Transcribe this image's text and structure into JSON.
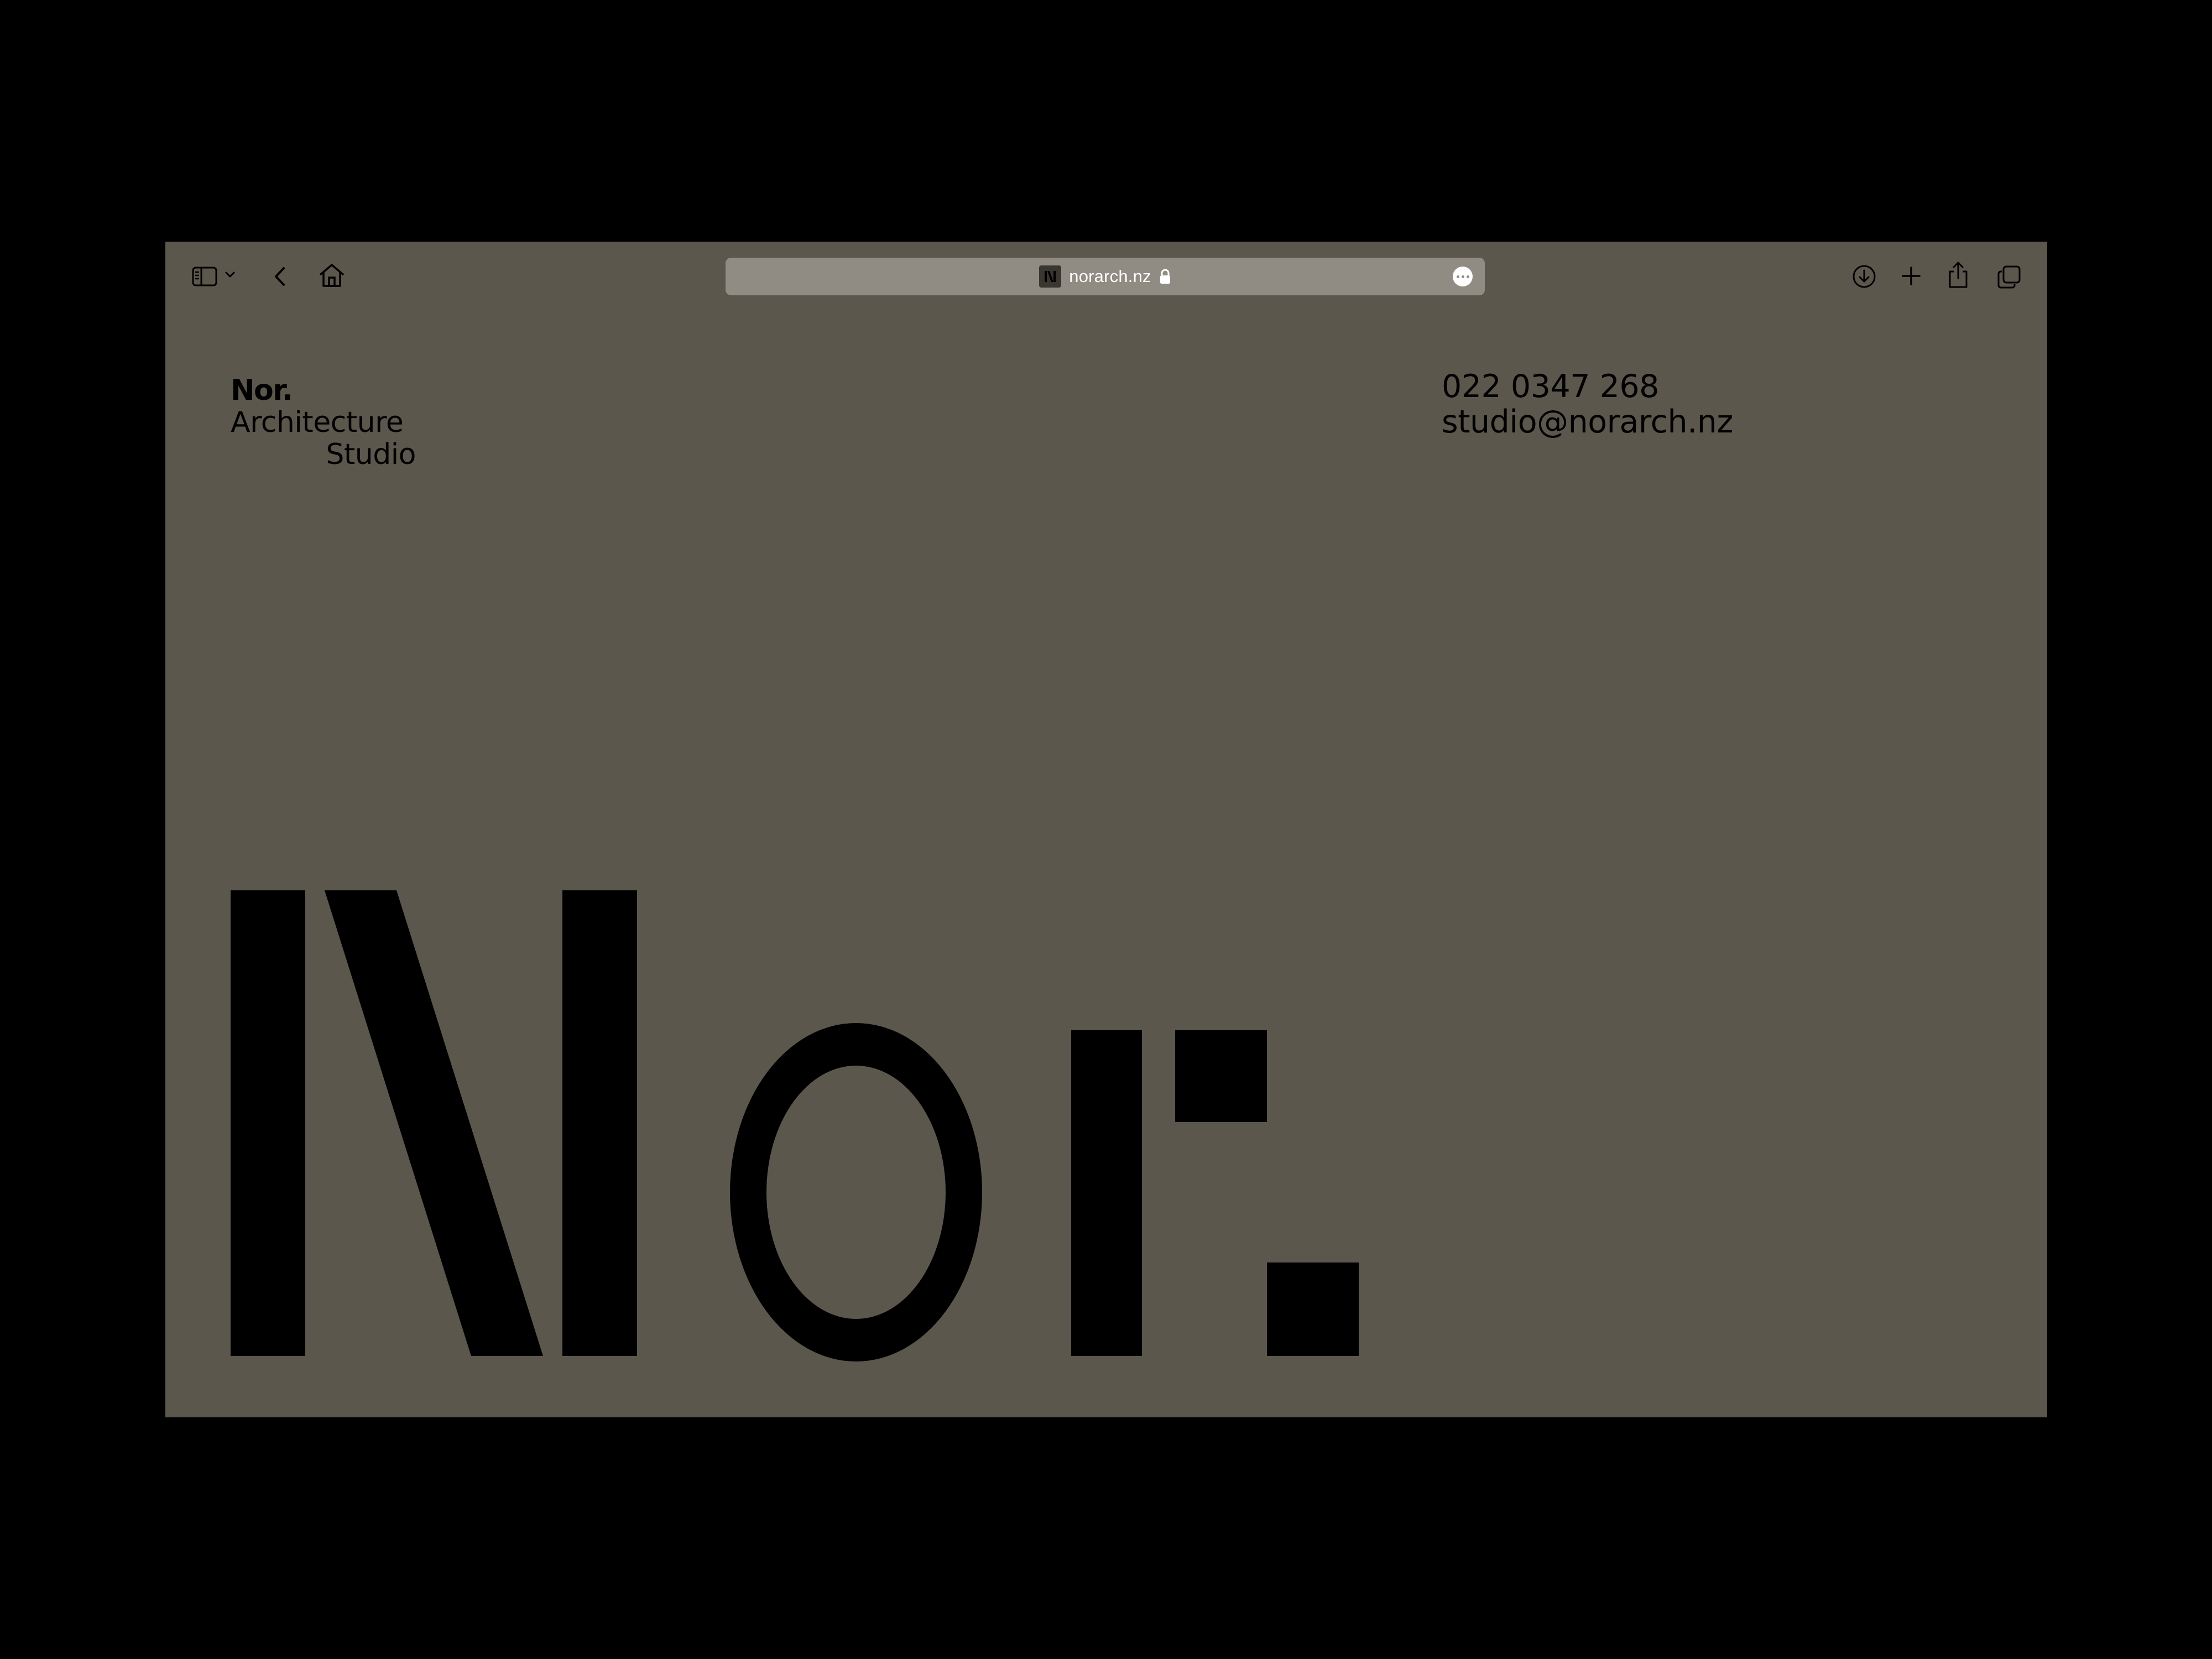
{
  "browser": {
    "url": "norarch.nz",
    "favicon_letter": "N",
    "toolbar_icons": [
      "sidebar-icon",
      "chevron-down-icon",
      "back-icon",
      "home-icon",
      "download-icon",
      "new-tab-icon",
      "share-icon",
      "tabs-overview-icon"
    ]
  },
  "site": {
    "logo": {
      "line1": "Nor.",
      "line2": "Architecture",
      "line3": "Studio"
    },
    "contact": {
      "phone": "022 0347 268",
      "email": "studio@norarch.nz"
    },
    "hero_wordmark": "Nor."
  },
  "colors": {
    "page_background": "#5b574d",
    "url_bar": "#908c83",
    "text": "#000000",
    "outer_background": "#000000"
  }
}
